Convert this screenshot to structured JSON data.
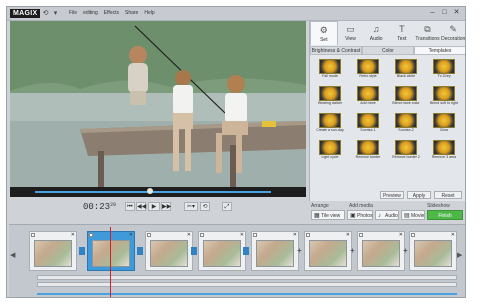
{
  "app": {
    "logo": "MAGIX",
    "menu": [
      "File",
      "editing",
      "Effects",
      "Share",
      "Help"
    ],
    "window_controls": [
      "minimize-icon",
      "maximize-icon",
      "close-icon"
    ]
  },
  "transport": {
    "timecode": "00:23",
    "timecode_frames": "20",
    "buttons": [
      "previous-icon",
      "rewind-icon",
      "play-icon",
      "fast-forward-icon",
      "cut-icon",
      "undo-icon",
      "fullscreen-icon"
    ]
  },
  "right_panel": {
    "tabs": [
      {
        "label": "Set",
        "icon": "set-icon"
      },
      {
        "label": "View",
        "icon": "view-icon"
      },
      {
        "label": "Audio",
        "icon": "audio-icon"
      },
      {
        "label": "Text",
        "icon": "text-icon"
      },
      {
        "label": "Transitions",
        "icon": "transitions-icon"
      },
      {
        "label": "Decoration",
        "icon": "decoration-icon"
      }
    ],
    "subtabs": [
      "Brightness & Contrast",
      "Color",
      "Templates"
    ],
    "templates": [
      "Fall mode",
      "Retro style",
      "Black white",
      "TV-Grey",
      "Wearing darker",
      "Add more",
      "Blend more color",
      "Blend soft to right",
      "Create a sun-day",
      "Sunrise-1",
      "Sunrise-2",
      "Glow",
      "Light cycle",
      "Remove border",
      "Remove border 2",
      "Remove 3 area"
    ],
    "footer_buttons": [
      "Preview",
      "Apply",
      "Reset"
    ]
  },
  "arrange": {
    "arrange_label": "Arrange",
    "add_media_label": "Add media",
    "slideshow_label": "Slideshow",
    "buttons": [
      "Tile view",
      "Photos",
      "Audio",
      "Movie"
    ],
    "finish_label": "Finish",
    "accent": "#4db847"
  },
  "storyboard": {
    "clip_count": 8,
    "selected_index": 1
  },
  "colors": {
    "accent_blue": "#3f9ad9",
    "playhead": "#d0202a"
  }
}
